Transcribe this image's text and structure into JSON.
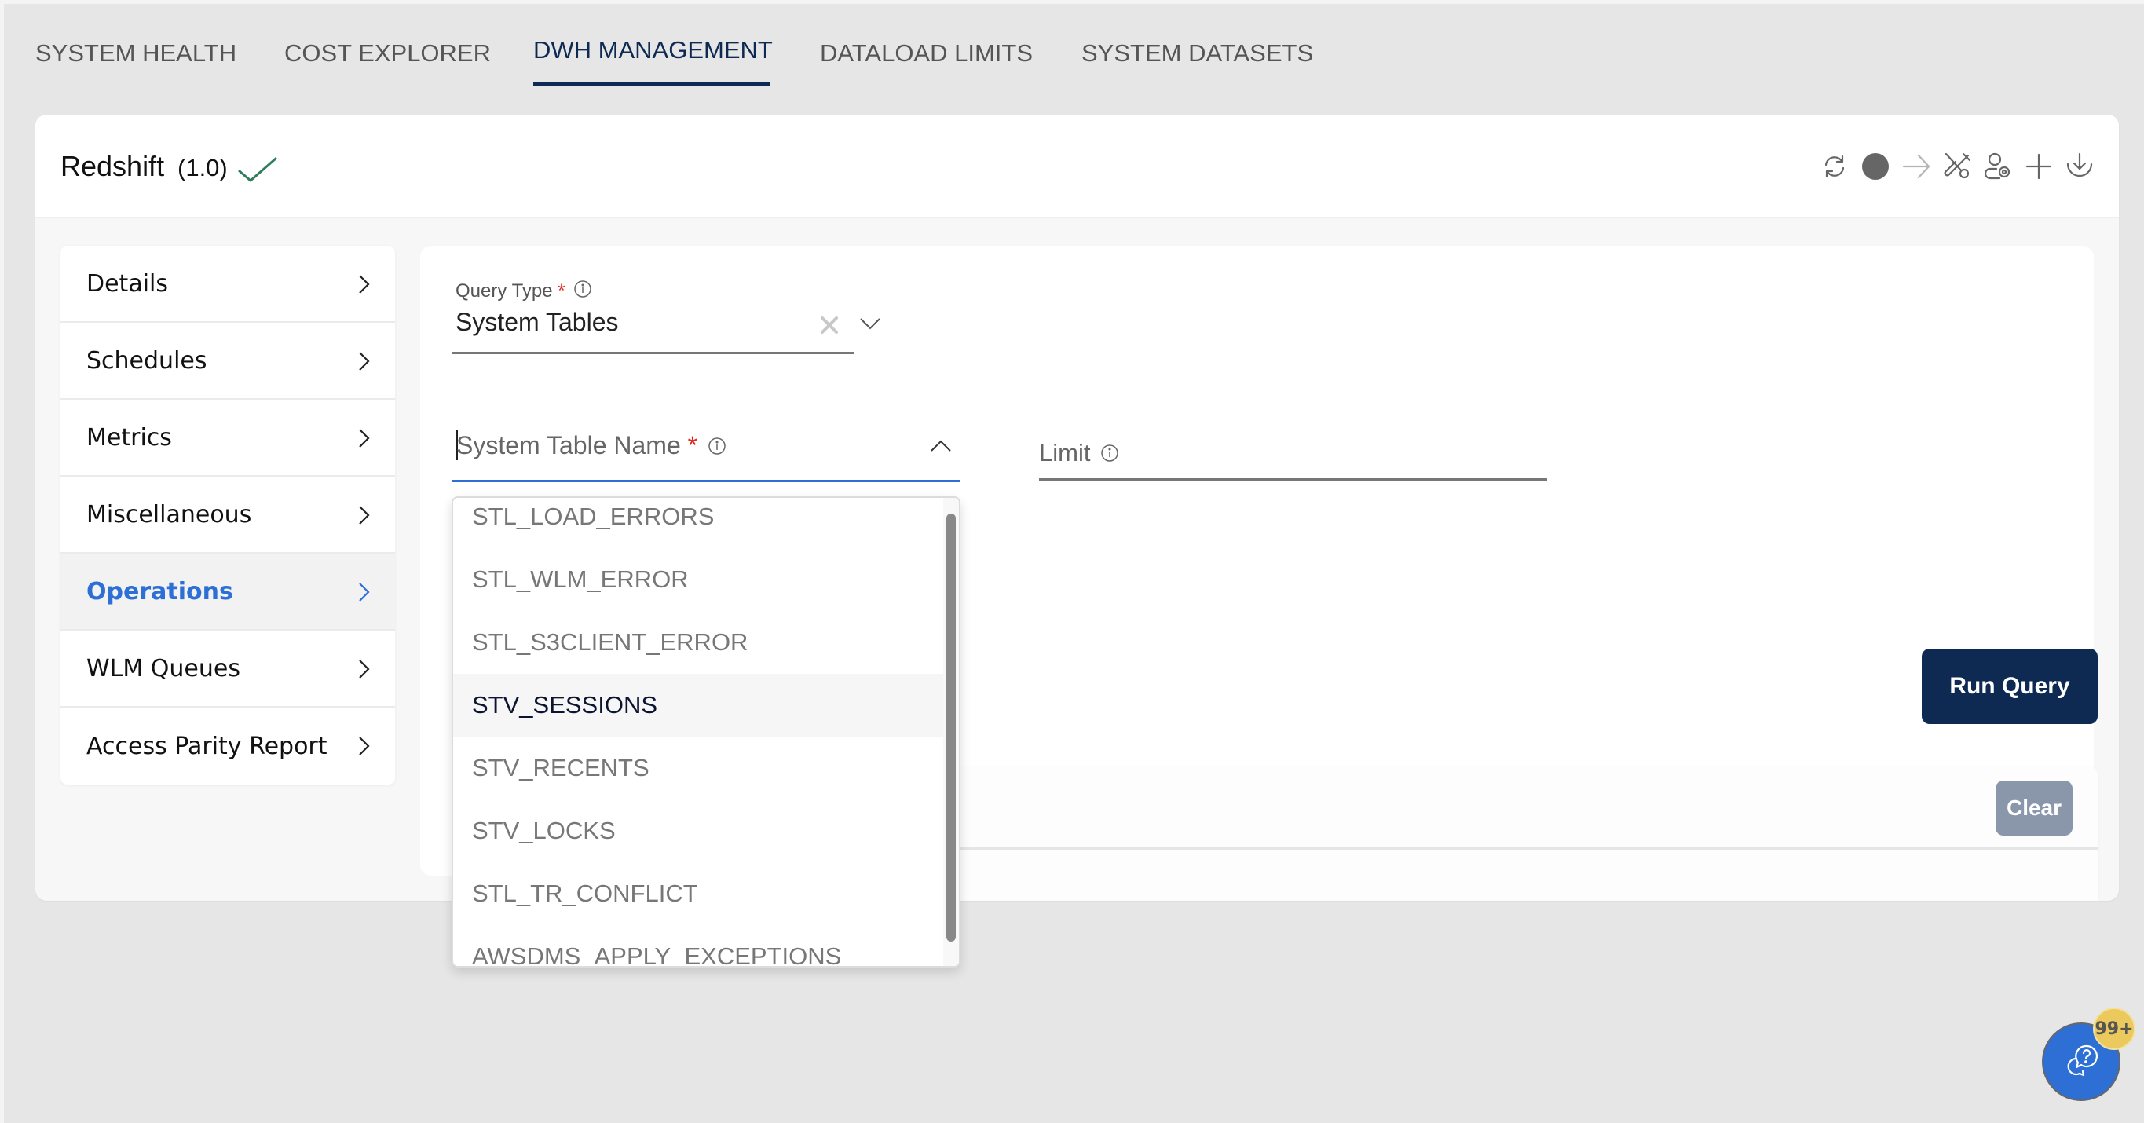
{
  "tabs": [
    {
      "label": "SYSTEM HEALTH",
      "active": false
    },
    {
      "label": "COST EXPLORER",
      "active": false
    },
    {
      "label": "DWH MANAGEMENT",
      "active": true
    },
    {
      "label": "DATALOAD LIMITS",
      "active": false
    },
    {
      "label": "SYSTEM DATASETS",
      "active": false
    }
  ],
  "header": {
    "title": "Redshift",
    "version": "(1.0)",
    "status_icon": "checkmark-icon",
    "status_color": "#2e7d5b",
    "toolbar": [
      {
        "name": "refresh-icon"
      },
      {
        "name": "status-dot-icon"
      },
      {
        "name": "arrow-right-icon",
        "disabled": true
      },
      {
        "name": "tools-icon"
      },
      {
        "name": "user-settings-icon"
      },
      {
        "name": "plus-icon"
      },
      {
        "name": "download-icon"
      }
    ]
  },
  "sidebar": {
    "items": [
      {
        "label": "Details",
        "active": false
      },
      {
        "label": "Schedules",
        "active": false
      },
      {
        "label": "Metrics",
        "active": false
      },
      {
        "label": "Miscellaneous",
        "active": false
      },
      {
        "label": "Operations",
        "active": true
      },
      {
        "label": "WLM Queues",
        "active": false
      },
      {
        "label": "Access Parity Report",
        "active": false
      }
    ]
  },
  "form": {
    "query_type": {
      "label": "Query Type",
      "required_mark": "*",
      "value": "System Tables"
    },
    "system_table_name": {
      "label": "System Table Name",
      "required_mark": "*",
      "value": "",
      "open": true
    },
    "limit": {
      "label": "Limit",
      "value": ""
    },
    "run_query_label": "Run Query",
    "clear_label": "Clear"
  },
  "dropdown": {
    "options": [
      {
        "label": "STL_LOAD_ERRORS",
        "hover": false
      },
      {
        "label": "STL_WLM_ERROR",
        "hover": false
      },
      {
        "label": "STL_S3CLIENT_ERROR",
        "hover": false
      },
      {
        "label": "STV_SESSIONS",
        "hover": true
      },
      {
        "label": "STV_RECENTS",
        "hover": false
      },
      {
        "label": "STV_LOCKS",
        "hover": false
      },
      {
        "label": "STL_TR_CONFLICT",
        "hover": false
      },
      {
        "label": "AWSDMS_APPLY_EXCEPTIONS",
        "hover": false
      }
    ]
  },
  "help": {
    "badge": "99+"
  },
  "colors": {
    "primary": "#0f2a52",
    "accent": "#2e6fd6",
    "required": "#e0281e",
    "clear_button": "#8a97aa",
    "badge": "#ecc95c"
  }
}
